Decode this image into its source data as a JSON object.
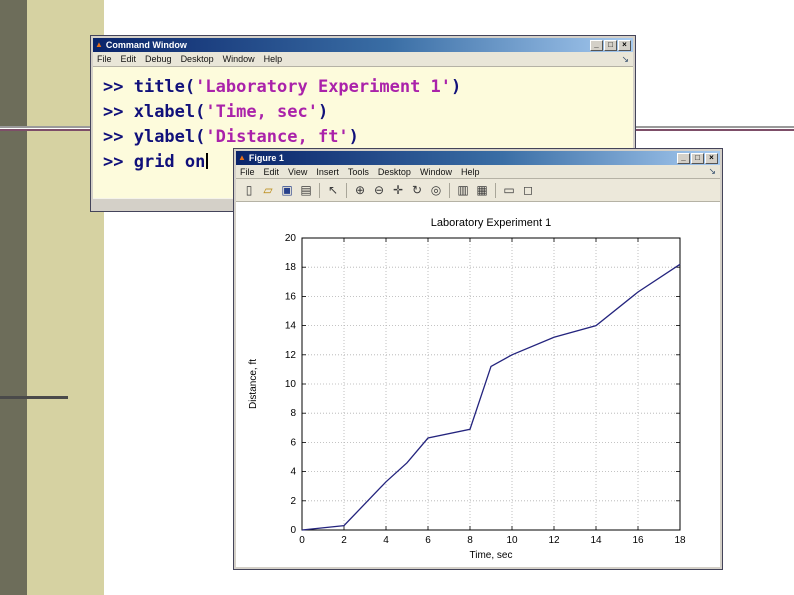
{
  "slide": {
    "background": "#ffffff",
    "left_dark_strip_color": "#6d6d5a",
    "left_band_color": "#d6d2a2",
    "accent_line_color": "#7d4e68",
    "accent_line2_color": "#4a4a4a"
  },
  "window_controls": [
    {
      "name": "minimize-button",
      "glyph": "_"
    },
    {
      "name": "maximize-button",
      "glyph": "□"
    },
    {
      "name": "close-button",
      "glyph": "×"
    }
  ],
  "command_window": {
    "title": "Command Window",
    "titlebar_icon": {
      "name": "matlab-icon",
      "glyph": "▲",
      "color": "#e8701a"
    },
    "menu": [
      "File",
      "Edit",
      "Debug",
      "Desktop",
      "Window",
      "Help"
    ],
    "dock_icon": {
      "name": "dock-icon",
      "glyph": "↘"
    },
    "colors": {
      "code": "#10107a",
      "string": "#aa22aa",
      "background": "#fdfbdc"
    },
    "lines": [
      {
        "segments": [
          {
            "text": ">> ",
            "type": "code"
          },
          {
            "text": "title(",
            "type": "code"
          },
          {
            "text": "'Laboratory Experiment 1'",
            "type": "string"
          },
          {
            "text": ")",
            "type": "code"
          }
        ]
      },
      {
        "segments": [
          {
            "text": ">> ",
            "type": "code"
          },
          {
            "text": "xlabel(",
            "type": "code"
          },
          {
            "text": "'Time, sec'",
            "type": "string"
          },
          {
            "text": ")",
            "type": "code"
          }
        ]
      },
      {
        "segments": [
          {
            "text": ">> ",
            "type": "code"
          },
          {
            "text": "ylabel(",
            "type": "code"
          },
          {
            "text": "'Distance, ft'",
            "type": "string"
          },
          {
            "text": ")",
            "type": "code"
          }
        ]
      },
      {
        "segments": [
          {
            "text": ">> ",
            "type": "code"
          },
          {
            "text": "grid on",
            "type": "code"
          }
        ],
        "cursor": true
      }
    ]
  },
  "figure_window": {
    "title": "Figure 1",
    "titlebar_icon": {
      "name": "figure-icon",
      "glyph": "▲",
      "color": "#e8701a"
    },
    "menu": [
      "File",
      "Edit",
      "View",
      "Insert",
      "Tools",
      "Desktop",
      "Window",
      "Help"
    ],
    "dock_icon": {
      "name": "dock-icon",
      "glyph": "↘"
    },
    "toolbar": {
      "icons": [
        {
          "name": "new-figure-icon",
          "glyph": "▯"
        },
        {
          "name": "open-file-icon",
          "glyph": "▱",
          "color": "#b8860b"
        },
        {
          "name": "save-figure-icon",
          "glyph": "▣",
          "color": "#27408b"
        },
        {
          "name": "print-figure-icon",
          "glyph": "▤"
        },
        {
          "name": "edit-plot-icon",
          "glyph": "↖"
        },
        {
          "name": "zoom-in-icon",
          "glyph": "⊕"
        },
        {
          "name": "zoom-out-icon",
          "glyph": "⊖"
        },
        {
          "name": "pan-icon",
          "glyph": "✛"
        },
        {
          "name": "rotate-3d-icon",
          "glyph": "↻"
        },
        {
          "name": "data-cursor-icon",
          "glyph": "◎"
        },
        {
          "name": "colorbar-icon",
          "glyph": "▥"
        },
        {
          "name": "legend-icon",
          "glyph": "▦"
        },
        {
          "name": "hide-plot-tools-icon",
          "glyph": "▭"
        },
        {
          "name": "show-plot-tools-icon",
          "glyph": "◻"
        }
      ],
      "separators_after": [
        3,
        4,
        9,
        11
      ]
    }
  },
  "chart_data": {
    "type": "line",
    "title": "Laboratory Experiment 1",
    "xlabel": "Time, sec",
    "ylabel": "Distance, ft",
    "x": [
      0,
      2,
      4,
      5,
      6,
      8,
      9,
      10,
      12,
      14,
      16,
      18
    ],
    "y": [
      0,
      0.3,
      3.3,
      4.6,
      6.3,
      6.9,
      11.2,
      12.0,
      13.2,
      14.0,
      16.3,
      18.2
    ],
    "xlim": [
      0,
      18
    ],
    "ylim": [
      0,
      20
    ],
    "xticks": [
      0,
      2,
      4,
      6,
      8,
      10,
      12,
      14,
      16,
      18
    ],
    "yticks": [
      0,
      2,
      4,
      6,
      8,
      10,
      12,
      14,
      16,
      18,
      20
    ],
    "grid": true,
    "legend": null,
    "line_color": "#24247e"
  }
}
